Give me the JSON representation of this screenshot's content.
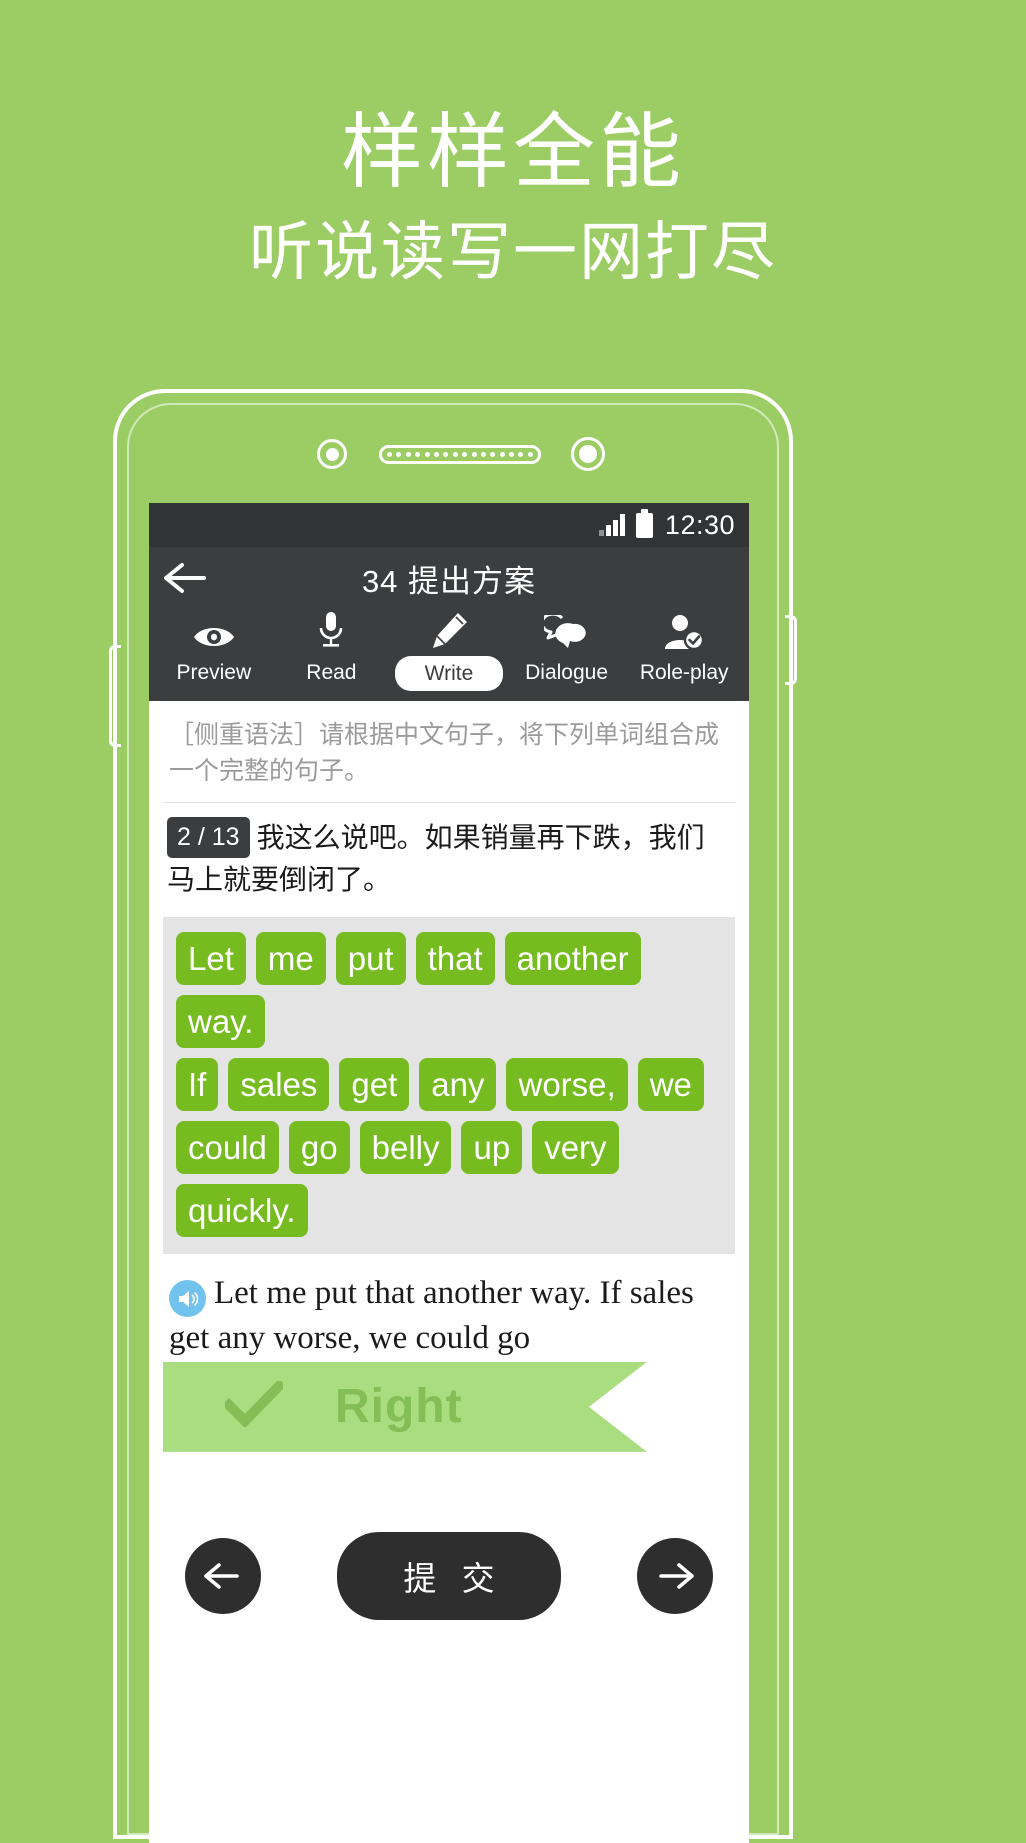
{
  "promo": {
    "title": "样样全能",
    "subtitle": "听说读写一网打尽"
  },
  "colors": {
    "background": "#9ccd65",
    "tile": "#76bc21",
    "appbar": "#3b3d3f",
    "ribbon": "#aadd80",
    "ribbon_text": "#85bd57",
    "speaker_icon": "#72c2ee"
  },
  "phone": {
    "statusbar": {
      "time": "12:30",
      "signal_icon": "signal-bars-icon",
      "battery_icon": "battery-full-icon"
    },
    "appbar": {
      "back_icon": "back-arrow-icon",
      "title": "34 提出方案",
      "tabs": [
        {
          "label": "Preview",
          "icon": "eye-icon",
          "active": false
        },
        {
          "label": "Read",
          "icon": "microphone-icon",
          "active": false
        },
        {
          "label": "Write",
          "icon": "pencil-icon",
          "active": true
        },
        {
          "label": "Dialogue",
          "icon": "speech-bubbles-icon",
          "active": false
        },
        {
          "label": "Role-play",
          "icon": "person-check-icon",
          "active": false
        }
      ]
    },
    "content": {
      "instruction": "［侧重语法］请根据中文句子，将下列单词组合成一个完整的句子。",
      "question_badge": "2 / 13",
      "question_text": "我这么说吧。如果销量再下跌，我们马上就要倒闭了。",
      "word_tiles": [
        [
          "Let",
          "me",
          "put",
          "that",
          "another",
          "way."
        ],
        [
          "If",
          "sales",
          "get",
          "any",
          "worse,",
          "we"
        ],
        [
          "could",
          "go",
          "belly",
          "up",
          "very",
          "quickly."
        ]
      ],
      "answer_icon": "speaker-icon",
      "answer_text": "Let me put that another way. If sales get any worse, we could go",
      "result_banner": {
        "icon": "check-icon",
        "label": "Right"
      }
    },
    "bottombar": {
      "prev_icon": "arrow-left-icon",
      "submit_label": "提 交",
      "next_icon": "arrow-right-icon"
    }
  }
}
